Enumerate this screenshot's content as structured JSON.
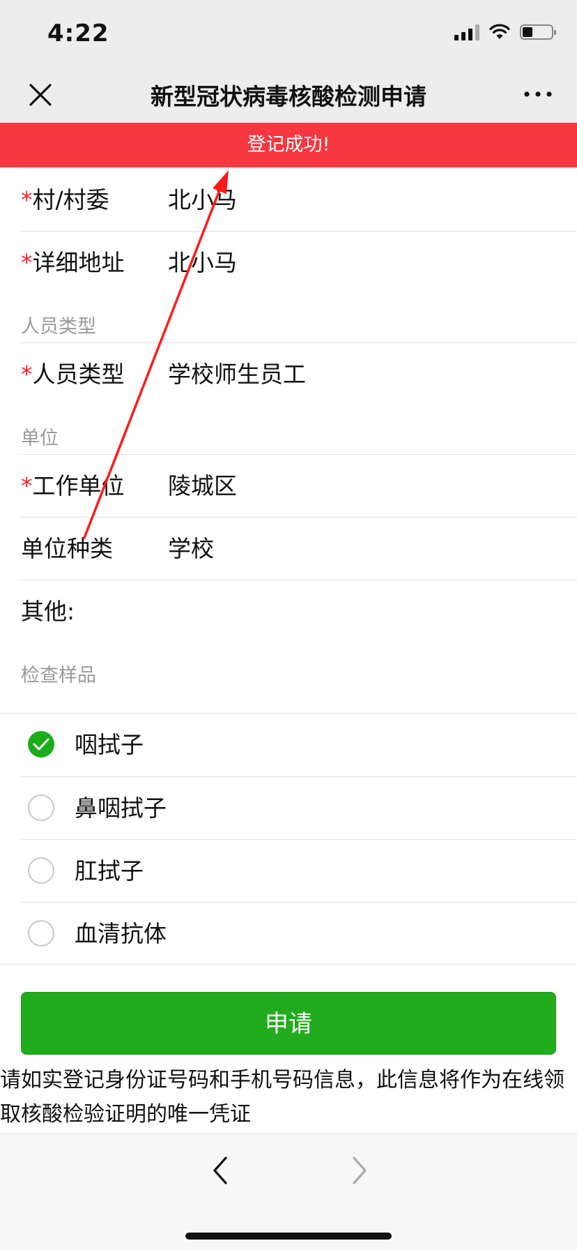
{
  "status_bar": {
    "time": "4:22"
  },
  "nav": {
    "title": "新型冠状病毒核酸检测申请"
  },
  "toast": {
    "message": "登记成功!"
  },
  "form": {
    "required_mark": "*",
    "village": {
      "label": "村/村委",
      "value": "北小马"
    },
    "address": {
      "label": "详细地址",
      "value": "北小马"
    },
    "person_type_section": "人员类型",
    "person_type": {
      "label": "人员类型",
      "value": "学校师生员工"
    },
    "unit_section": "单位",
    "work_unit": {
      "label": "工作单位",
      "value": "陵城区"
    },
    "unit_kind": {
      "label": "单位种类",
      "value": "学校"
    },
    "other": {
      "label": "其他:"
    },
    "sample_section": "检查样品",
    "samples": [
      {
        "label": "咽拭子",
        "checked": true
      },
      {
        "label": "鼻咽拭子",
        "checked": false
      },
      {
        "label": "肛拭子",
        "checked": false
      },
      {
        "label": "血清抗体",
        "checked": false
      }
    ]
  },
  "apply_button": {
    "label": "申请"
  },
  "notice": {
    "text": "请如实登记身份证号码和手机号码信息，此信息将作为在线领取核酸检验证明的唯一凭证"
  },
  "colors": {
    "accent_green": "#22ab1c",
    "toast_red": "#f5373f",
    "required_red": "#f5222d",
    "annotation_red": "#ff1a1a"
  },
  "icons": {
    "close": "close-icon",
    "more": "more-icon",
    "back": "back-arrow-icon",
    "forward": "forward-arrow-icon",
    "check": "check-icon"
  }
}
